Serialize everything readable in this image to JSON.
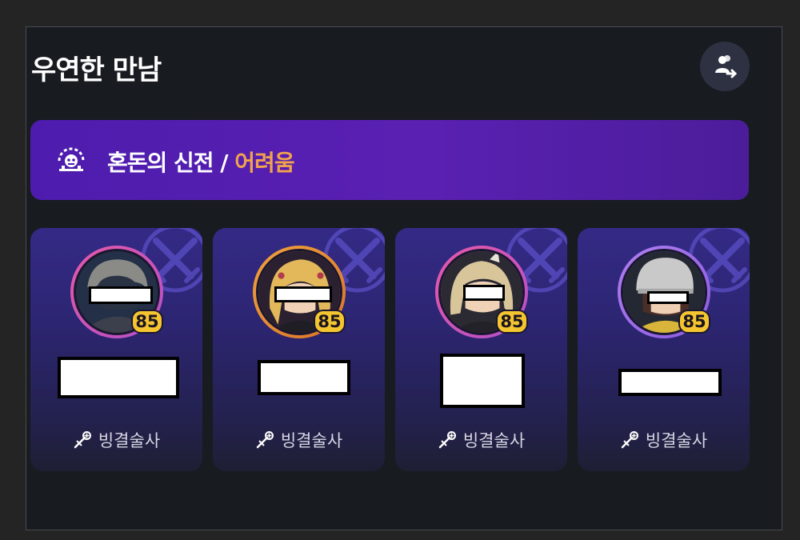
{
  "page": {
    "title": "우연한 만남"
  },
  "header": {
    "party_icon": "party-transfer-icon"
  },
  "dungeon": {
    "icon": "chaos-temple-icon",
    "name": "혼돈의 신전",
    "separator": " / ",
    "difficulty": "어려움",
    "difficulty_color": "#f1a24d"
  },
  "members": [
    {
      "level": "85",
      "class_name": "빙결술사",
      "class_icon": "ice-mage-staff-icon",
      "ring_colors": [
        "#e65aa8",
        "#b24fc9"
      ]
    },
    {
      "level": "85",
      "class_name": "빙결술사",
      "class_icon": "ice-mage-staff-icon",
      "ring_colors": [
        "#f0a23c",
        "#d9732a"
      ]
    },
    {
      "level": "85",
      "class_name": "빙결술사",
      "class_icon": "ice-mage-staff-icon",
      "ring_colors": [
        "#e65aa8",
        "#b24fc9"
      ]
    },
    {
      "level": "85",
      "class_name": "빙결술사",
      "class_icon": "ice-mage-staff-icon",
      "ring_colors": [
        "#b07ff0",
        "#8a5ae0"
      ]
    }
  ],
  "colors": {
    "card_watermark": "crossed-swords-icon",
    "level_badge": "#f5c530"
  }
}
